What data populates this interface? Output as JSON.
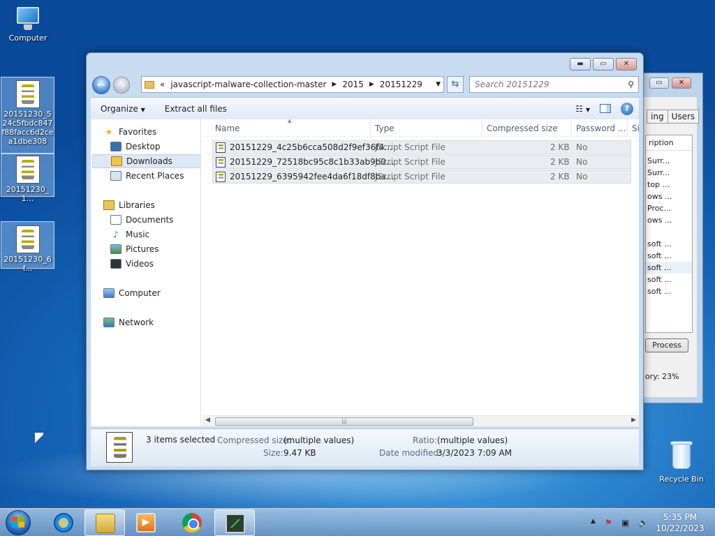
{
  "desktop": {
    "computer_label": "Computer",
    "file1_label": "20151230_524c5fbdc847f88facc6d2cea1dbe308",
    "file2_label": "20151230_1...",
    "file3_label": "20151230_6f...",
    "recycle_label": "Recycle Bin"
  },
  "bg_window": {
    "tab_label": "ing",
    "tab_users": "Users",
    "col_header": "ription",
    "rows": [
      "Surr...",
      "Surr...",
      "top ...",
      "ows ...",
      "Proc...",
      "ows ...",
      "",
      "soft ...",
      "soft ...",
      "soft ...",
      "soft ...",
      "soft ..."
    ],
    "process_button": "Process",
    "memory_text": "ory: 23%"
  },
  "explorer": {
    "caption_min": "▭",
    "caption_max": "▣",
    "caption_close": "✕",
    "breadcrumb_prefix": "«",
    "breadcrumbs": [
      "javascript-malware-collection-master",
      "2015",
      "20151229"
    ],
    "search_placeholder": "Search 20151229",
    "toolbar": {
      "organize": "Organize",
      "extract_all": "Extract all files"
    },
    "nav": {
      "favorites": "Favorites",
      "desktop": "Desktop",
      "downloads": "Downloads",
      "recent_places": "Recent Places",
      "libraries": "Libraries",
      "documents": "Documents",
      "music": "Music",
      "pictures": "Pictures",
      "videos": "Videos",
      "computer": "Computer",
      "network": "Network"
    },
    "columns": {
      "name": "Name",
      "type": "Type",
      "compressed_size": "Compressed size",
      "password": "Password ...",
      "size": "Si"
    },
    "files": [
      {
        "name": "20151229_4c25b6cca508d2f9ef36f4...",
        "type": "JScript Script File",
        "compressed": "2 KB",
        "password": "No"
      },
      {
        "name": "20151229_72518bc95c8c1b33ab9b0...",
        "type": "JScript Script File",
        "compressed": "2 KB",
        "password": "No"
      },
      {
        "name": "20151229_6395942fee4da6f18df8ba...",
        "type": "JScript Script File",
        "compressed": "2 KB",
        "password": "No"
      }
    ],
    "details": {
      "selection": "3 items selected",
      "compressed_key": "Compressed size:",
      "compressed_val": "(multiple values)",
      "size_key": "Size:",
      "size_val": "9.47 KB",
      "ratio_key": "Ratio:",
      "ratio_val": "(multiple values)",
      "modified_key": "Date modified:",
      "modified_val": "3/3/2023 7:09 AM"
    }
  },
  "taskbar": {
    "time": "5:35 PM",
    "date": "10/22/2023"
  }
}
